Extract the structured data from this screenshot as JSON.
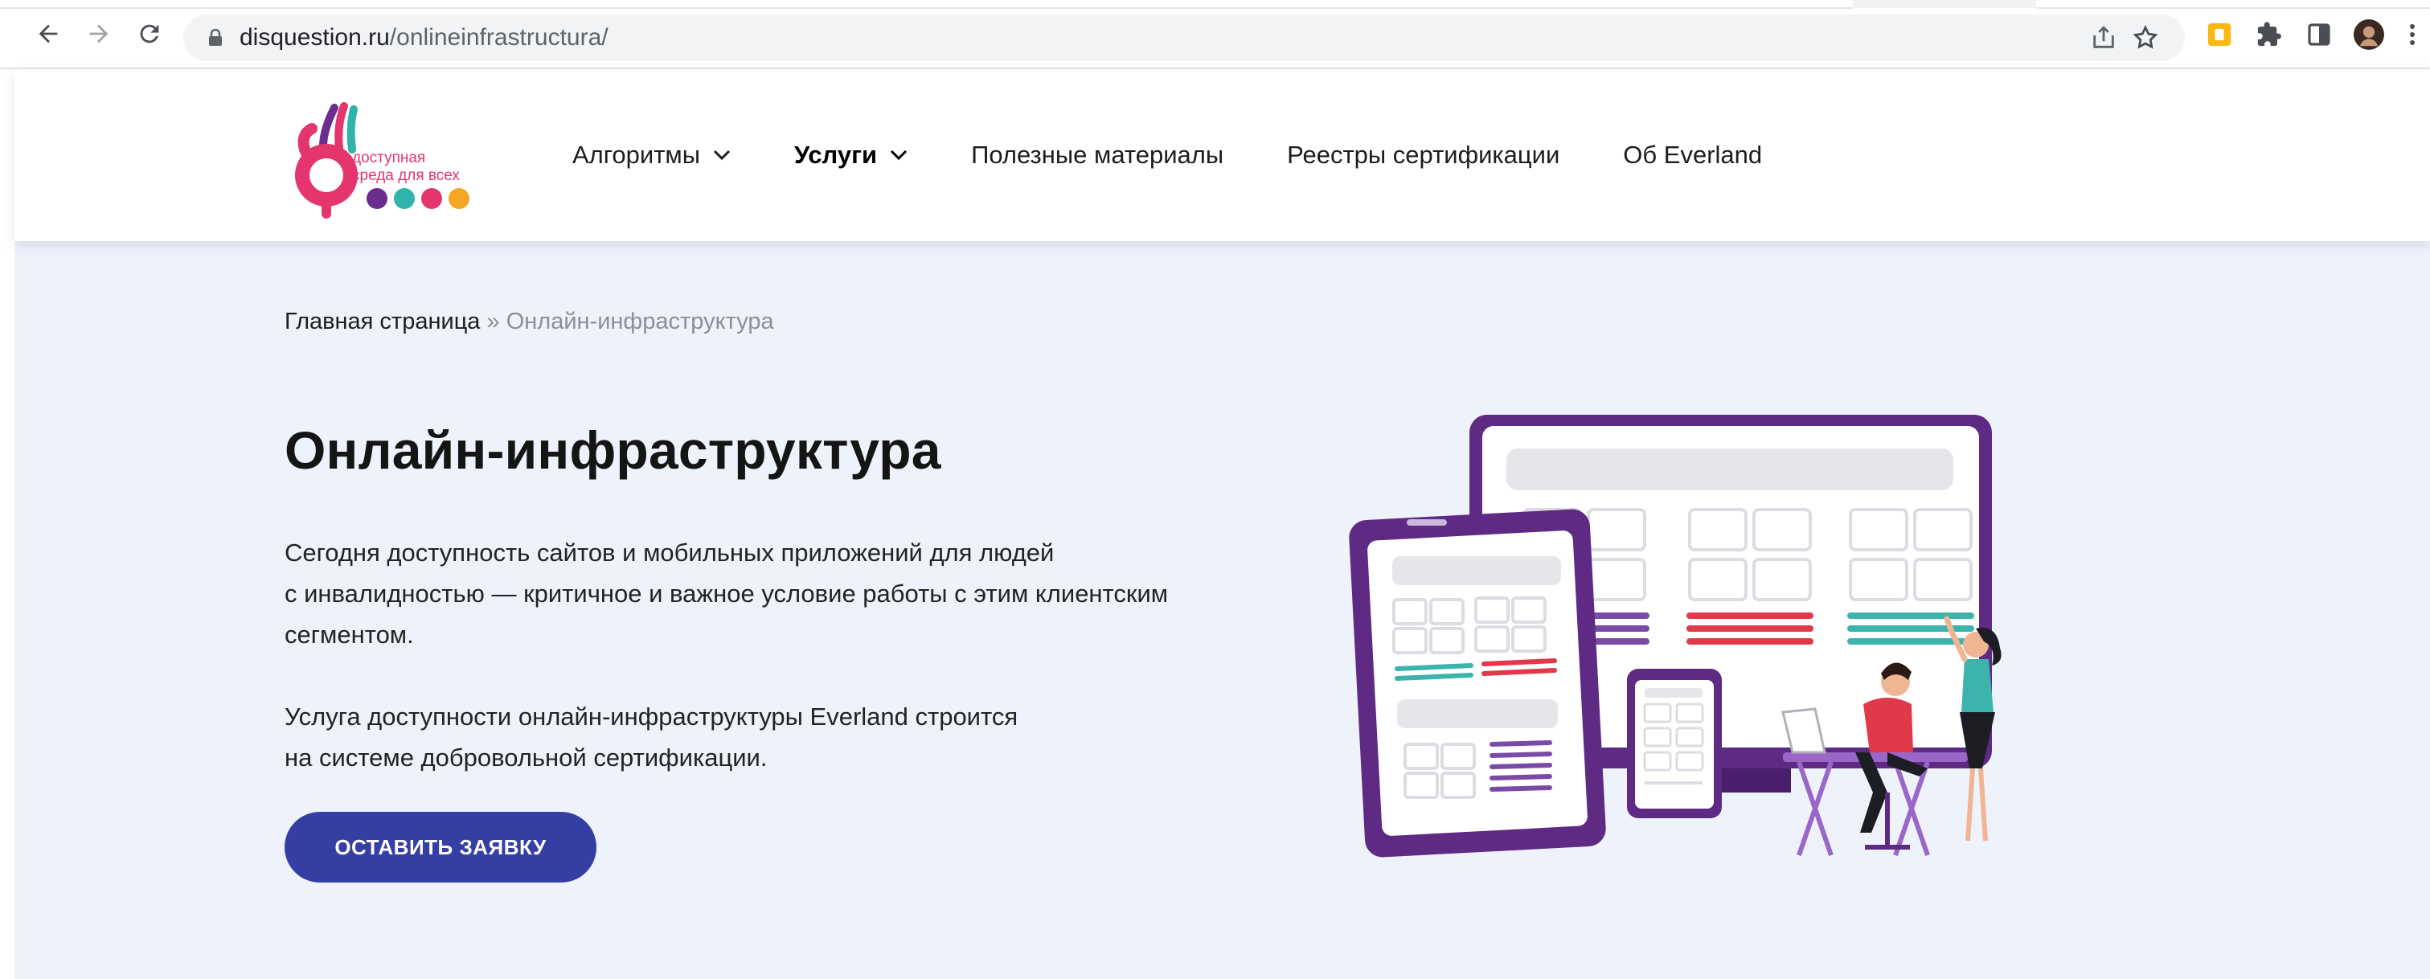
{
  "browser": {
    "url_domain": "disquestion.ru",
    "url_path": "/onlineinfrastructura/",
    "toolbar_icons": [
      "back-icon",
      "forward-icon",
      "reload-icon",
      "lock-icon",
      "share-icon",
      "bookmark-star-icon",
      "extension-icon",
      "puzzle-icon",
      "side-panel-icon",
      "profile-avatar",
      "more-icon"
    ]
  },
  "header": {
    "logo_text_line1": "доступная",
    "logo_text_line2": "среда для всех",
    "nav": [
      {
        "label": "Алгоритмы",
        "has_dropdown": true,
        "active": false
      },
      {
        "label": "Услуги",
        "has_dropdown": true,
        "active": true
      },
      {
        "label": "Полезные материалы",
        "has_dropdown": false,
        "active": false
      },
      {
        "label": "Реестры сертификации",
        "has_dropdown": false,
        "active": false
      },
      {
        "label": "Об Everland",
        "has_dropdown": false,
        "active": false
      }
    ]
  },
  "breadcrumb": {
    "home": "Главная страница",
    "separator": "»",
    "current": "Онлайн-инфраструктура"
  },
  "main": {
    "title": "Онлайн-инфраструктура",
    "paragraph1": [
      "Сегодня доступность сайтов и мобильных приложений для людей",
      "с инвалидностью — критичное и важное условие работы с этим клиентским",
      "сегментом."
    ],
    "paragraph2": [
      "Услуга доступности онлайн-инфраструктуры Everland строится",
      "на системе добровольной сертификации."
    ],
    "cta_label": "ОСТАВИТЬ ЗАЯВКУ"
  },
  "colors": {
    "accent": "#353fa3",
    "content_bg": "#eef2fb",
    "logo_red": "#e5356d",
    "logo_purple": "#6b2d8f",
    "illustration_purple": "#5e2a84",
    "illustration_red": "#e03a4a",
    "illustration_teal": "#3cb4ac"
  }
}
